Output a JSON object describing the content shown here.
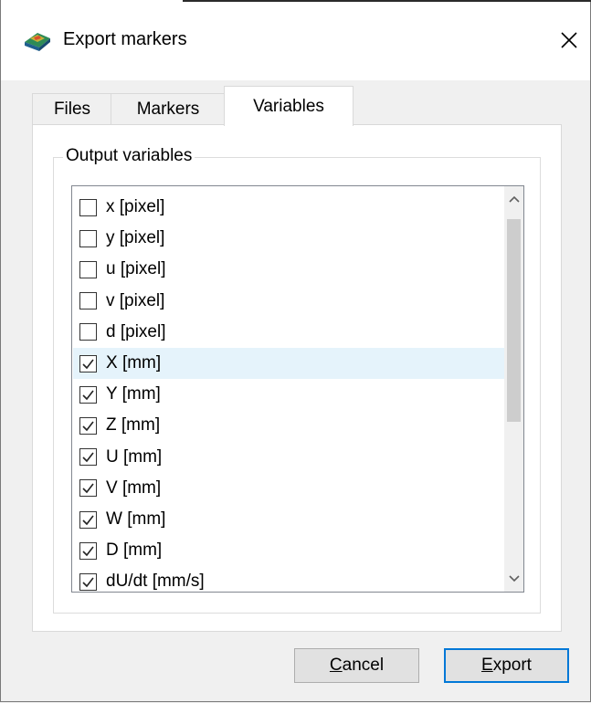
{
  "window": {
    "title": "Export markers",
    "app_icon": "app-icon",
    "close_icon": "close-icon"
  },
  "tabs": [
    {
      "label": "Files",
      "active": false
    },
    {
      "label": "Markers",
      "active": false
    },
    {
      "label": "Variables",
      "active": true
    }
  ],
  "group": {
    "legend": "Output variables"
  },
  "variables": [
    {
      "label": "x [pixel]",
      "checked": false
    },
    {
      "label": "y [pixel]",
      "checked": false
    },
    {
      "label": "u [pixel]",
      "checked": false
    },
    {
      "label": "v [pixel]",
      "checked": false
    },
    {
      "label": "d [pixel]",
      "checked": false
    },
    {
      "label": "X [mm]",
      "checked": true
    },
    {
      "label": "Y [mm]",
      "checked": true
    },
    {
      "label": "Z [mm]",
      "checked": true
    },
    {
      "label": "U [mm]",
      "checked": true
    },
    {
      "label": "V [mm]",
      "checked": true
    },
    {
      "label": "W [mm]",
      "checked": true
    },
    {
      "label": "D [mm]",
      "checked": true
    },
    {
      "label": "dU/dt [mm/s]",
      "checked": true
    }
  ],
  "buttons": {
    "cancel_first": "C",
    "cancel_rest": "ancel",
    "export_first": "E",
    "export_rest": "xport"
  },
  "colors": {
    "accent": "#0078d7",
    "hover_row": "#e5f3fb"
  }
}
